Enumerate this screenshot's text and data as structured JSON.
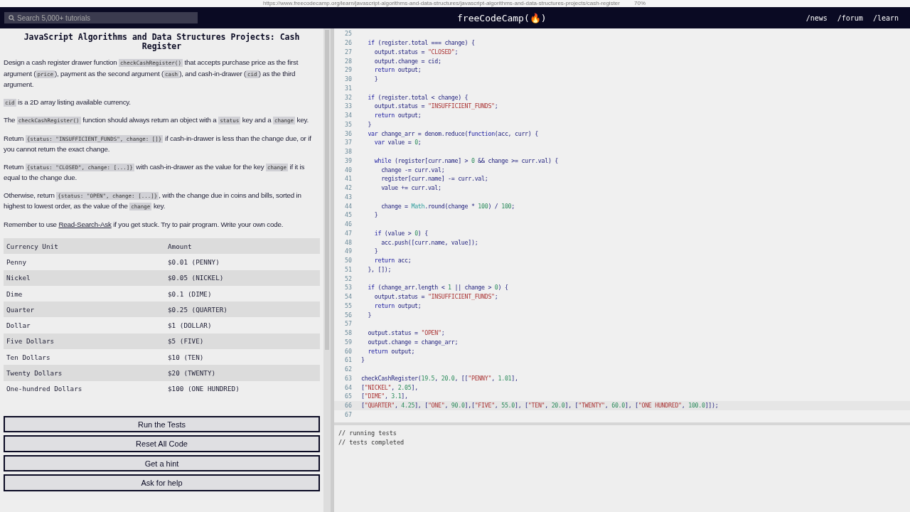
{
  "browser": {
    "url": "https://www.freecodecamp.org/learn/javascript-algorithms-and-data-structures/javascript-algorithms-and-data-structures-projects/cash-register",
    "zoom": "70%"
  },
  "nav": {
    "search_placeholder": "Search 5,000+ tutorials",
    "logo": "freeCodeCamp(🔥)",
    "links": [
      "/news",
      "/forum",
      "/learn"
    ]
  },
  "challenge": {
    "title": "JavaScript Algorithms and Data Structures Projects: Cash Register",
    "paragraphs": [
      [
        {
          "kind": "text",
          "text": "Design a cash register drawer function "
        },
        {
          "kind": "code",
          "text": "checkCashRegister()"
        },
        {
          "kind": "text",
          "text": " that accepts purchase price as the first argument ("
        },
        {
          "kind": "code",
          "text": "price"
        },
        {
          "kind": "text",
          "text": "), payment as the second argument ("
        },
        {
          "kind": "code",
          "text": "cash"
        },
        {
          "kind": "text",
          "text": "), and cash-in-drawer ("
        },
        {
          "kind": "code",
          "text": "cid"
        },
        {
          "kind": "text",
          "text": ") as the third argument."
        }
      ],
      [
        {
          "kind": "code",
          "text": "cid"
        },
        {
          "kind": "text",
          "text": " is a 2D array listing available currency."
        }
      ],
      [
        {
          "kind": "text",
          "text": "The "
        },
        {
          "kind": "code",
          "text": "checkCashRegister()"
        },
        {
          "kind": "text",
          "text": " function should always return an object with a "
        },
        {
          "kind": "code",
          "text": "status"
        },
        {
          "kind": "text",
          "text": " key and a "
        },
        {
          "kind": "code",
          "text": "change"
        },
        {
          "kind": "text",
          "text": " key."
        }
      ],
      [
        {
          "kind": "text",
          "text": "Return "
        },
        {
          "kind": "code",
          "text": "{status: \"INSUFFICIENT_FUNDS\", change: []}"
        },
        {
          "kind": "text",
          "text": " if cash-in-drawer is less than the change due, or if you cannot return the exact change."
        }
      ],
      [
        {
          "kind": "text",
          "text": "Return "
        },
        {
          "kind": "code",
          "text": "{status: \"CLOSED\", change: [...]}"
        },
        {
          "kind": "text",
          "text": " with cash-in-drawer as the value for the key "
        },
        {
          "kind": "code",
          "text": "change"
        },
        {
          "kind": "text",
          "text": " if it is equal to the change due."
        }
      ],
      [
        {
          "kind": "text",
          "text": "Otherwise, return "
        },
        {
          "kind": "code",
          "text": "{status: \"OPEN\", change: [...]}"
        },
        {
          "kind": "text",
          "text": ", with the change due in coins and bills, sorted in highest to lowest order, as the value of the "
        },
        {
          "kind": "code",
          "text": "change"
        },
        {
          "kind": "text",
          "text": " key."
        }
      ],
      [
        {
          "kind": "text",
          "text": "Remember to use "
        },
        {
          "kind": "link",
          "text": "Read-Search-Ask"
        },
        {
          "kind": "text",
          "text": " if you get stuck. Try to pair program. Write your own code."
        }
      ]
    ],
    "table": {
      "columns": [
        "Currency Unit",
        "Amount"
      ],
      "rows": [
        [
          "Penny",
          "$0.01 (PENNY)"
        ],
        [
          "Nickel",
          "$0.05 (NICKEL)"
        ],
        [
          "Dime",
          "$0.1 (DIME)"
        ],
        [
          "Quarter",
          "$0.25 (QUARTER)"
        ],
        [
          "Dollar",
          "$1 (DOLLAR)"
        ],
        [
          "Five Dollars",
          "$5 (FIVE)"
        ],
        [
          "Ten Dollars",
          "$10 (TEN)"
        ],
        [
          "Twenty Dollars",
          "$20 (TWENTY)"
        ],
        [
          "One-hundred Dollars",
          "$100 (ONE HUNDRED)"
        ]
      ]
    },
    "buttons": [
      "Run the Tests",
      "Reset All Code",
      "Get a hint",
      "Ask for help"
    ]
  },
  "editor": {
    "lines": [
      {
        "number": "25"
      },
      {
        "number": "26",
        "code": "  if (register.total === change) {"
      },
      {
        "number": "27",
        "code": "    output.status = \"CLOSED\";"
      },
      {
        "number": "28",
        "code": "    output.change = cid;"
      },
      {
        "number": "29",
        "code": "    return output;"
      },
      {
        "number": "30",
        "code": "    }"
      },
      {
        "number": "31"
      },
      {
        "number": "32",
        "code": "  if (register.total < change) {"
      },
      {
        "number": "33",
        "code": "    output.status = \"INSUFFICIENT_FUNDS\";"
      },
      {
        "number": "34",
        "code": "    return output;"
      },
      {
        "number": "35",
        "code": "  }"
      },
      {
        "number": "36",
        "code": "  var change_arr = denom.reduce(function(acc, curr) {"
      },
      {
        "number": "37",
        "code": "    var value = 0;"
      },
      {
        "number": "38"
      },
      {
        "number": "39",
        "code": "    while (register[curr.name] > 0 && change >= curr.val) {"
      },
      {
        "number": "40",
        "code": "      change -= curr.val;"
      },
      {
        "number": "41",
        "code": "      register[curr.name] -= curr.val;"
      },
      {
        "number": "42",
        "code": "      value += curr.val;"
      },
      {
        "number": "43"
      },
      {
        "number": "44",
        "code": "      change = Math.round(change * 100) / 100;"
      },
      {
        "number": "45",
        "code": "    }"
      },
      {
        "number": "46"
      },
      {
        "number": "47",
        "code": "    if (value > 0) {"
      },
      {
        "number": "48",
        "code": "      acc.push([curr.name, value]);"
      },
      {
        "number": "49",
        "code": "    }"
      },
      {
        "number": "50",
        "code": "    return acc;"
      },
      {
        "number": "51",
        "code": "  }, []);"
      },
      {
        "number": "52"
      },
      {
        "number": "53",
        "code": "  if (change_arr.length < 1 || change > 0) {"
      },
      {
        "number": "54",
        "code": "    output.status = \"INSUFFICIENT_FUNDS\";"
      },
      {
        "number": "55",
        "code": "    return output;"
      },
      {
        "number": "56",
        "code": "  }"
      },
      {
        "number": "57"
      },
      {
        "number": "58",
        "code": "  output.status = \"OPEN\";"
      },
      {
        "number": "59",
        "code": "  output.change = change_arr;"
      },
      {
        "number": "60",
        "code": "  return output;"
      },
      {
        "number": "61",
        "code": "}"
      },
      {
        "number": "62"
      },
      {
        "number": "63",
        "code": "checkCashRegister(19.5, 20.0, [[\"PENNY\", 1.01],"
      },
      {
        "number": "64",
        "code": "[\"NICKEL\", 2.05],"
      },
      {
        "number": "65",
        "code": "[\"DIME\", 3.1],"
      },
      {
        "number": "66",
        "code": "[\"QUARTER\", 4.25], [\"ONE\", 90.0],[\"FIVE\", 55.0], [\"TEN\", 20.0], [\"TWENTY\", 60.0], [\"ONE HUNDRED\", 100.0]]);"
      },
      {
        "number": "67"
      }
    ],
    "output": [
      "// running tests",
      "// tests completed"
    ]
  }
}
